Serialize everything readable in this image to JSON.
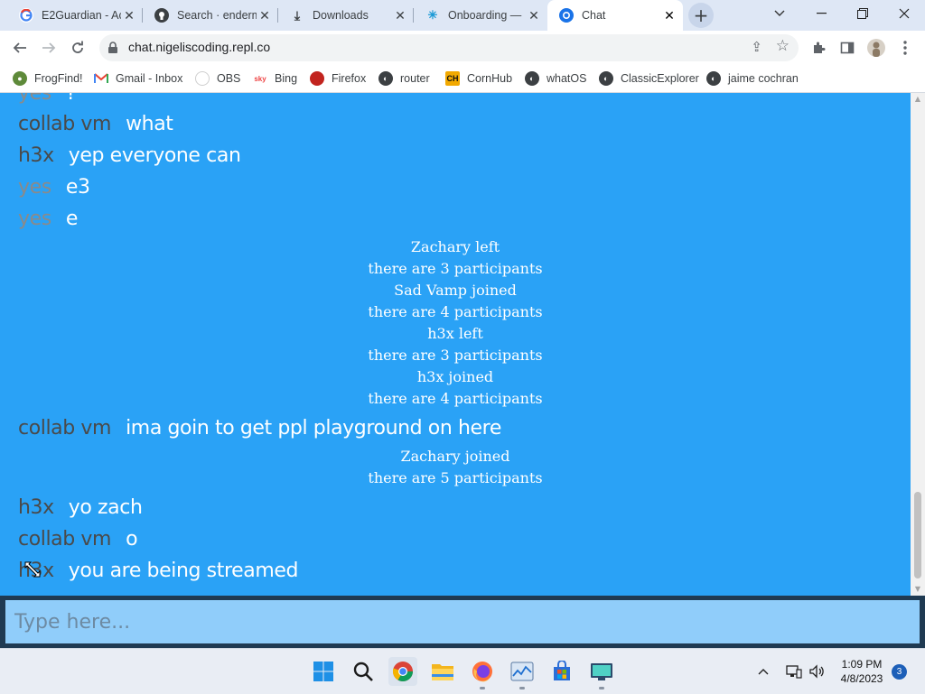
{
  "browser": {
    "tabs": [
      {
        "title": "E2Guardian - Ac",
        "icon": "google-icon"
      },
      {
        "title": "Search · enderm",
        "icon": "github-icon"
      },
      {
        "title": "Downloads",
        "icon": "download-icon"
      },
      {
        "title": "Onboarding —",
        "icon": "onboarding-icon"
      },
      {
        "title": "Chat",
        "icon": "chat-icon"
      }
    ],
    "url": "chat.nigeliscoding.repl.co",
    "bookmarks": [
      {
        "label": "FrogFind!",
        "icon": "frog-icon"
      },
      {
        "label": "Gmail - Inbox",
        "icon": "gmail-icon"
      },
      {
        "label": "OBS",
        "icon": "obs-icon"
      },
      {
        "label": "Bing",
        "icon": "bing-icon"
      },
      {
        "label": "Firefox",
        "icon": "firefox-icon"
      },
      {
        "label": "router",
        "icon": "globe-icon"
      },
      {
        "label": "CornHub",
        "icon": "ch-icon"
      },
      {
        "label": "whatOS",
        "icon": "globe-icon"
      },
      {
        "label": "ClassicExplorer",
        "icon": "globe-icon"
      },
      {
        "label": "jaime cochran",
        "icon": "globe-icon"
      }
    ]
  },
  "chat": {
    "messages": [
      {
        "user": "yes",
        "text": "?"
      },
      {
        "user": "collab vm",
        "text": "what"
      },
      {
        "user": "h3x",
        "text": "yep everyone can"
      },
      {
        "user": "yes",
        "text": "e3"
      },
      {
        "user": "yes",
        "text": "e"
      },
      {
        "user": "collab vm",
        "text": "ima goin to get ppl playground on here"
      },
      {
        "user": "h3x",
        "text": "yo zach"
      },
      {
        "user": "collab vm",
        "text": "o"
      },
      {
        "user": "h3x",
        "text": "you are being streamed"
      }
    ],
    "system": [
      "Zachary left",
      "there are 3 participants",
      "Sad Vamp joined",
      "there are 4 participants",
      "h3x left",
      "there are 3 participants",
      "h3x joined",
      "there are 4 participants",
      "Zachary joined",
      "there are 5 participants"
    ],
    "input_placeholder": "Type here..."
  },
  "colors": {
    "chat_background": "#2aa2f6",
    "input_background": "#90cdfa",
    "input_frame": "#1f3a52"
  },
  "taskbar": {
    "apps": [
      "windows-start-icon",
      "search-icon",
      "chrome-icon",
      "file-explorer-icon",
      "firefox-icon",
      "task-manager-icon",
      "microsoft-store-icon",
      "remote-desktop-icon"
    ],
    "time": "1:09 PM",
    "date": "4/8/2023",
    "notifications": "3"
  }
}
